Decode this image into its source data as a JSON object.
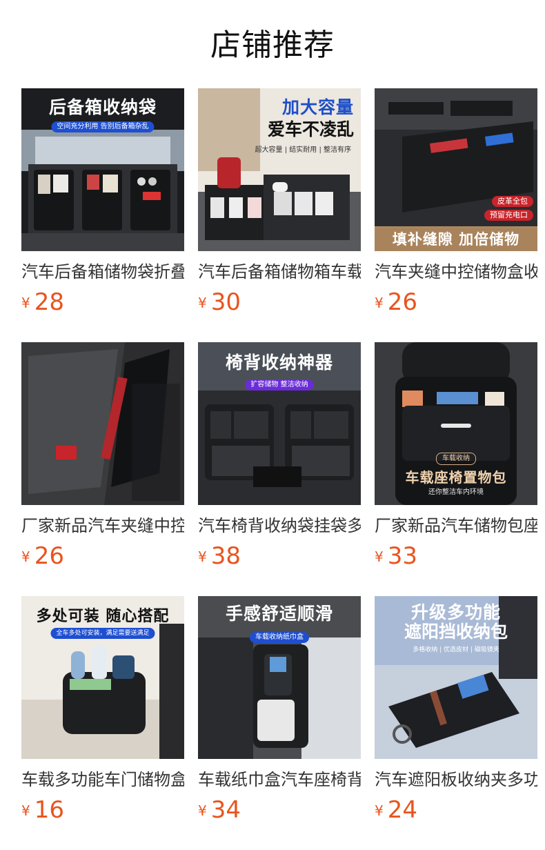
{
  "section_title": "店铺推荐",
  "products": [
    {
      "name": "汽车后备箱储物袋折叠置物箱",
      "currency": "¥",
      "price": "28",
      "image_text": [
        "后备箱收纳袋",
        "空间充分利用 告别后备箱杂乱"
      ]
    },
    {
      "name": "汽车后备箱储物箱车载收纳箱",
      "currency": "¥",
      "price": "30",
      "image_text": [
        "加大容量",
        "爱车不凌乱",
        "超大容量 | 结实耐用 | 整洁有序"
      ]
    },
    {
      "name": "汽车夹缝中控储物盒收纳盒",
      "currency": "¥",
      "price": "26",
      "image_text": [
        "皮革全包",
        "预留充电口",
        "填补缝隙 加倍储物"
      ]
    },
    {
      "name": "厂家新品汽车夹缝中控储物盒",
      "currency": "¥",
      "price": "26",
      "image_text": []
    },
    {
      "name": "汽车椅背收纳袋挂袋多功能",
      "currency": "¥",
      "price": "38",
      "image_text": [
        "椅背收纳神器",
        "扩容储物 整洁收纳"
      ]
    },
    {
      "name": "厂家新品汽车储物包座椅置物",
      "currency": "¥",
      "price": "33",
      "image_text": [
        "车载收纳",
        "车载座椅置物包",
        "还你整洁车内环境"
      ]
    },
    {
      "name": "车载多功能车门储物盒收纳",
      "currency": "¥",
      "price": "16",
      "image_text": [
        "多处可装 随心搭配",
        "全车多处可安装，满足需要送满足"
      ]
    },
    {
      "name": "车载纸巾盒汽车座椅背挂式",
      "currency": "¥",
      "price": "34",
      "image_text": [
        "手感舒适顺滑",
        "车载收纳纸巾盒"
      ]
    },
    {
      "name": "汽车遮阳板收纳夹多功能",
      "currency": "¥",
      "price": "24",
      "image_text": [
        "升级多功能",
        "遮阳挡收纳包",
        "多格收纳 | 优选皮材 | 磁吸镜夹"
      ]
    }
  ],
  "colors": {
    "price": "#e8541e",
    "title": "#111111",
    "name": "#333333"
  }
}
